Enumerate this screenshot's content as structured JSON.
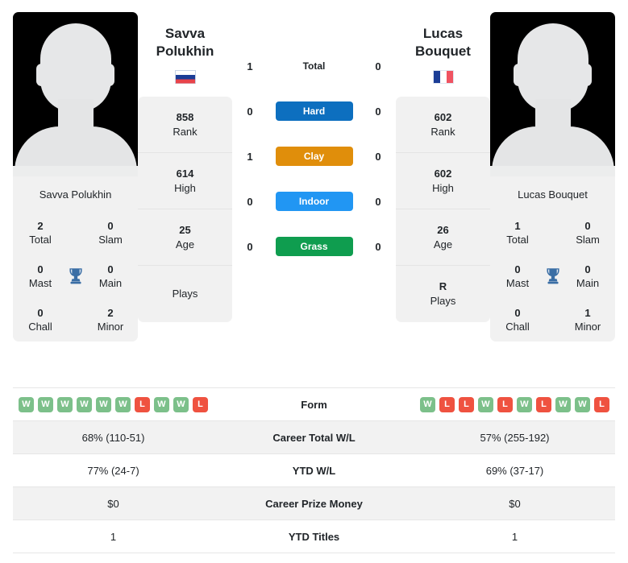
{
  "players": {
    "left": {
      "full_name": "Savva Polukhin",
      "card_name": "Savva Polukhin",
      "flag": "russia-flag",
      "flag_name": "Russia",
      "titles": [
        {
          "value": "2",
          "label": "Total"
        },
        {
          "value": "0",
          "label": "Slam"
        },
        {
          "value": "0",
          "label": "Mast"
        },
        {
          "value": "0",
          "label": "Main"
        },
        {
          "value": "0",
          "label": "Chall"
        },
        {
          "value": "2",
          "label": "Minor"
        }
      ],
      "info": [
        {
          "value": "858",
          "label": "Rank"
        },
        {
          "value": "614",
          "label": "High"
        },
        {
          "value": "25",
          "label": "Age"
        },
        {
          "value": "",
          "label": "Plays"
        }
      ],
      "form": [
        "W",
        "W",
        "W",
        "W",
        "W",
        "W",
        "L",
        "W",
        "W",
        "L"
      ]
    },
    "right": {
      "full_name": "Lucas Bouquet",
      "card_name": "Lucas Bouquet",
      "flag": "france-flag",
      "flag_name": "France",
      "titles": [
        {
          "value": "1",
          "label": "Total"
        },
        {
          "value": "0",
          "label": "Slam"
        },
        {
          "value": "0",
          "label": "Mast"
        },
        {
          "value": "0",
          "label": "Main"
        },
        {
          "value": "0",
          "label": "Chall"
        },
        {
          "value": "1",
          "label": "Minor"
        }
      ],
      "info": [
        {
          "value": "602",
          "label": "Rank"
        },
        {
          "value": "602",
          "label": "High"
        },
        {
          "value": "26",
          "label": "Age"
        },
        {
          "value": "R",
          "label": "Plays"
        }
      ],
      "form": [
        "W",
        "L",
        "L",
        "W",
        "L",
        "W",
        "L",
        "W",
        "W",
        "L"
      ]
    }
  },
  "h2h": [
    {
      "label": "Total",
      "left": "1",
      "right": "0",
      "type": "text"
    },
    {
      "label": "Hard",
      "left": "0",
      "right": "0",
      "type": "badge",
      "color": "#0d6fbf"
    },
    {
      "label": "Clay",
      "left": "1",
      "right": "0",
      "type": "badge",
      "color": "#e08e0b"
    },
    {
      "label": "Indoor",
      "left": "0",
      "right": "0",
      "type": "badge",
      "color": "#2196f3"
    },
    {
      "label": "Grass",
      "left": "0",
      "right": "0",
      "type": "badge",
      "color": "#0f9d4f"
    }
  ],
  "table": [
    {
      "label": "Form",
      "left": "",
      "right": "",
      "type": "form",
      "alt": false
    },
    {
      "label": "Career Total W/L",
      "left": "68% (110-51)",
      "right": "57% (255-192)",
      "type": "text",
      "alt": true
    },
    {
      "label": "YTD W/L",
      "left": "77% (24-7)",
      "right": "69% (37-17)",
      "type": "text",
      "alt": false
    },
    {
      "label": "Career Prize Money",
      "left": "$0",
      "right": "$0",
      "type": "text",
      "alt": true
    },
    {
      "label": "YTD Titles",
      "left": "1",
      "right": "1",
      "type": "text",
      "alt": false
    }
  ],
  "colors": {
    "win_badge": "#7cc08a",
    "loss_badge": "#ef5240",
    "card_bg": "#f1f1f1",
    "row_alt_bg": "#f2f2f2",
    "trophy": "#3a6ea5"
  },
  "icons": {
    "trophy": "trophy-icon"
  }
}
